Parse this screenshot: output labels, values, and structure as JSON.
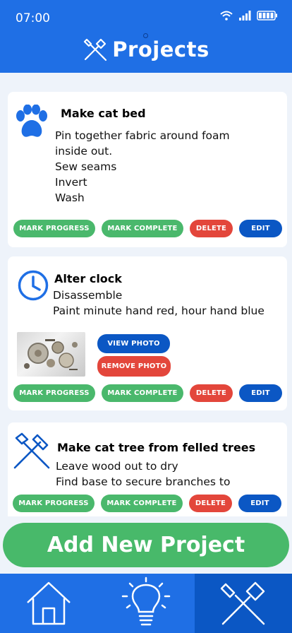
{
  "status_bar": {
    "time": "07:00"
  },
  "header": {
    "title": "Projects",
    "title_icon": "tools-icon"
  },
  "projects": [
    {
      "icon": "paw-icon",
      "title": "Make cat bed",
      "steps": [
        "Pin together fabric around foam",
        "inside out.",
        "Sew seams",
        "Invert",
        "Wash"
      ],
      "buttons": {
        "progress": "MARK PROGRESS",
        "complete": "MARK COMPLETE",
        "delete": "DELETE",
        "edit": "EDIT"
      }
    },
    {
      "icon": "clock-icon",
      "title": "Alter clock",
      "steps": [
        "Disassemble",
        "Paint minute hand red, hour hand blue"
      ],
      "photo_buttons": {
        "view": "VIEW PHOTO",
        "remove": "REMOVE PHOTO"
      },
      "buttons": {
        "progress": "MARK PROGRESS",
        "complete": "MARK COMPLETE",
        "delete": "DELETE",
        "edit": "EDIT"
      }
    },
    {
      "icon": "hammer-saw-icon",
      "title": "Make cat tree from felled trees",
      "steps": [
        "Leave wood out to dry",
        "Find base to secure branches to"
      ],
      "buttons": {
        "progress": "MARK PROGRESS",
        "complete": "MARK COMPLETE",
        "delete": "DELETE",
        "edit": "EDIT"
      }
    }
  ],
  "add_button": {
    "label": "Add New Project"
  },
  "nav": [
    {
      "icon": "home-icon",
      "active": false
    },
    {
      "icon": "lightbulb-icon",
      "active": false
    },
    {
      "icon": "tools-icon",
      "active": true
    }
  ],
  "colors": {
    "primary": "#1f6fe5",
    "dark_blue": "#0b57c4",
    "green": "#4ab86c",
    "red": "#e3463b",
    "background": "#eef3fa"
  }
}
